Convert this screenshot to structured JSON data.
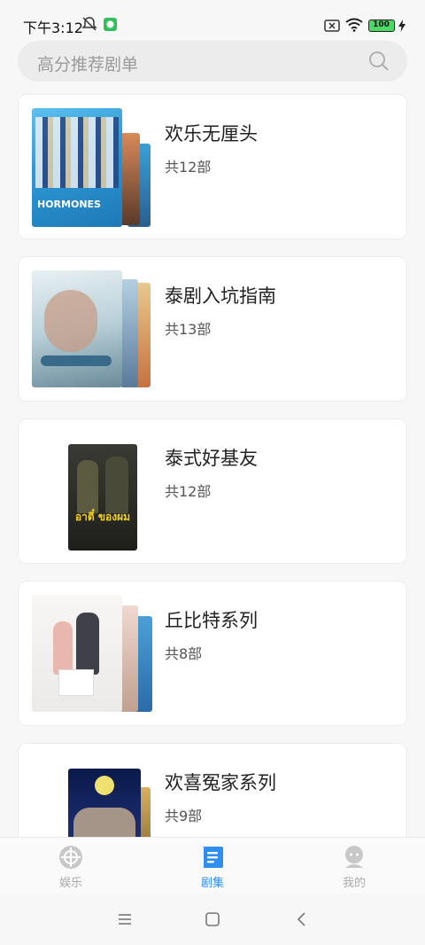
{
  "status_bar": {
    "time": "下午3:12",
    "battery": "100",
    "icons": [
      "bell-off-icon",
      "wechat-icon",
      "sim-x-icon",
      "wifi-icon",
      "battery-icon",
      "charging-icon"
    ]
  },
  "search": {
    "placeholder": "高分推荐剧单"
  },
  "lists": [
    {
      "title": "欢乐无厘头",
      "count": "共12部",
      "poster_text": "HORMONES"
    },
    {
      "title": "泰剧入坑指南",
      "count": "共13部"
    },
    {
      "title": "泰式好基友",
      "count": "共12部",
      "poster_text": "อาตี๋ ของผม"
    },
    {
      "title": "丘比特系列",
      "count": "共8部"
    },
    {
      "title": "欢喜冤家系列",
      "count": "共9部"
    }
  ],
  "bottom_nav": [
    {
      "label": "娱乐",
      "icon": "compass-icon",
      "active": false
    },
    {
      "label": "剧集",
      "icon": "playlist-icon",
      "active": true
    },
    {
      "label": "我的",
      "icon": "profile-icon",
      "active": false
    }
  ],
  "colors": {
    "accent": "#2f8ef0",
    "inactive": "#aaaaaa",
    "background": "#f7f7f7"
  }
}
